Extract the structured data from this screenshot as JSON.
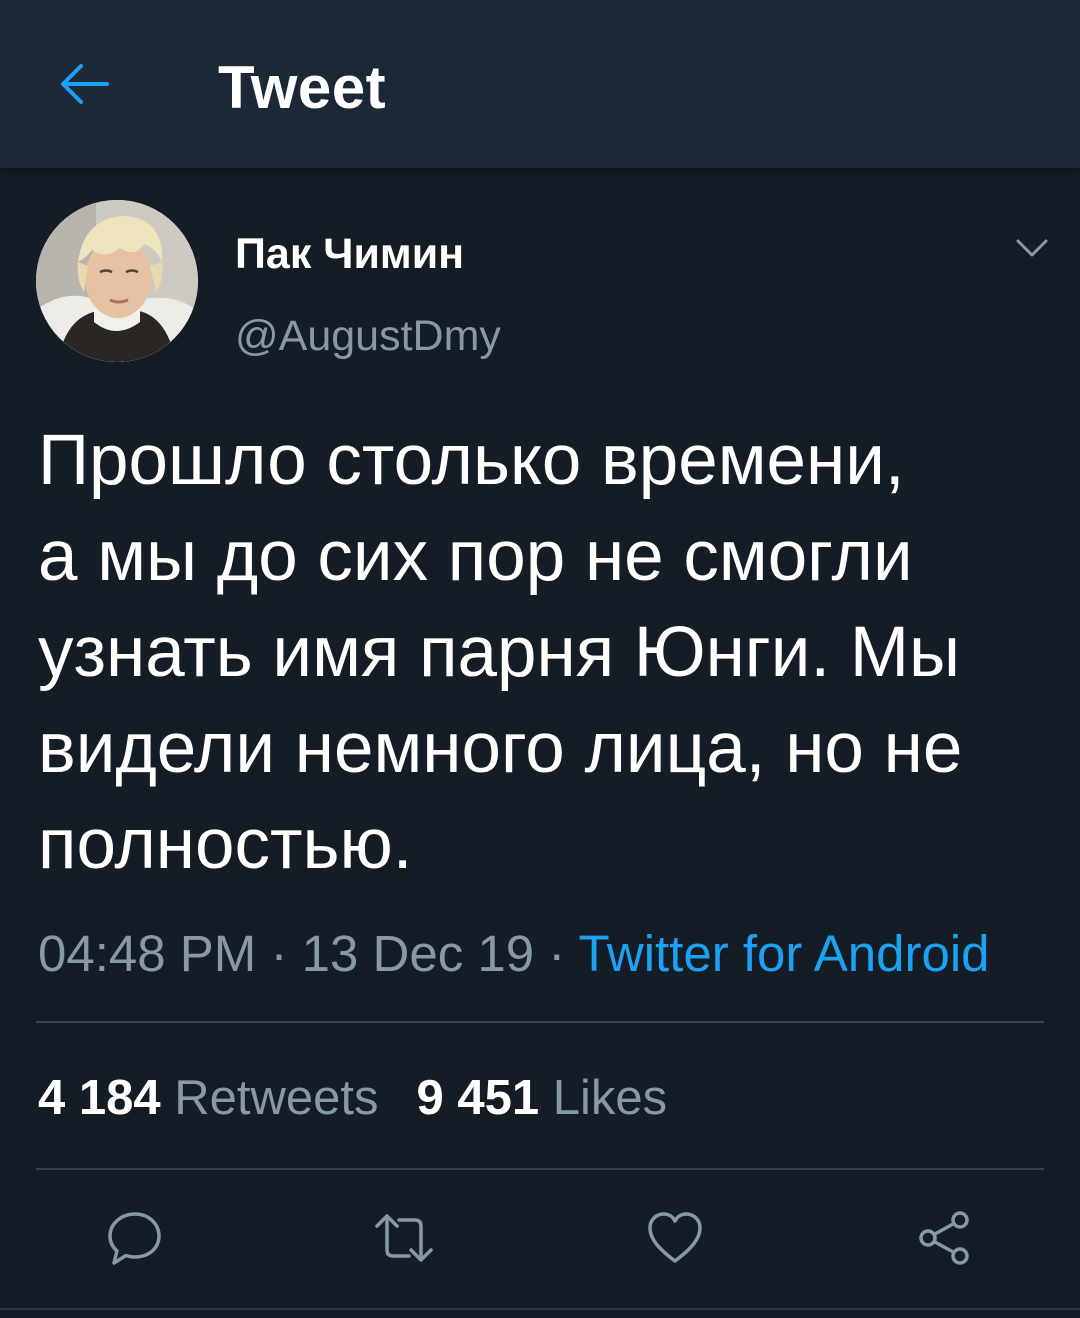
{
  "header": {
    "back_icon": "arrow-left-icon",
    "title": "Tweet"
  },
  "colors": {
    "background": "#141d26",
    "header_background": "#1b2836",
    "accent": "#1da1f2",
    "secondary_text": "#8899a6",
    "divider": "#38444d"
  },
  "tweet": {
    "author": {
      "display_name": "Пак Чимин",
      "handle": "@AugustDmy"
    },
    "text": "Прошло столько времени,\nа мы до сих пор не смогли\nузнать имя парня Юнги. Мы\nвидели немного лица, но не\nполностью.",
    "time": "04:48 PM",
    "date": "13 Dec 19",
    "source": "Twitter for Android",
    "separator": " · ",
    "stats": {
      "retweets_count": "4 184",
      "retweets_label": "Retweets",
      "likes_count": "9 451",
      "likes_label": "Likes"
    }
  },
  "actions": [
    {
      "icon": "reply-icon"
    },
    {
      "icon": "retweet-icon"
    },
    {
      "icon": "like-icon"
    },
    {
      "icon": "share-icon"
    }
  ]
}
